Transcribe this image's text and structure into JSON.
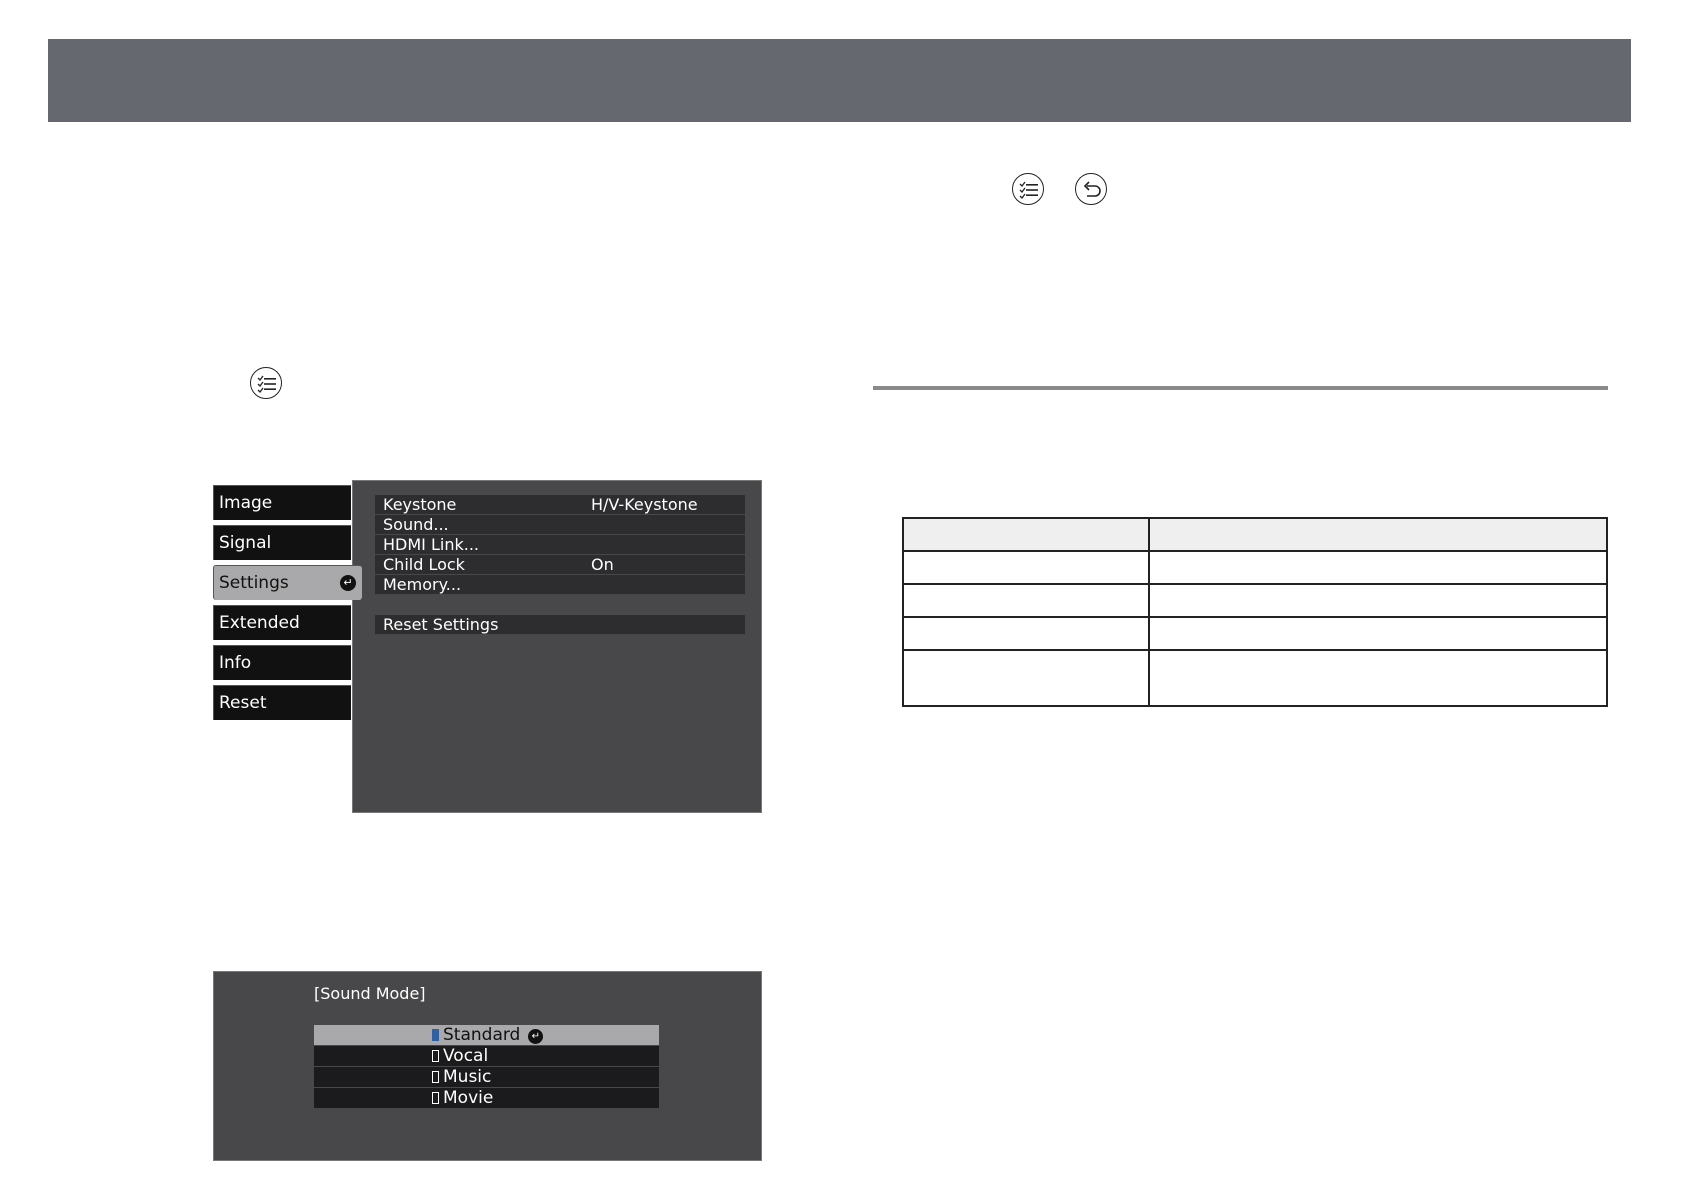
{
  "icons": {
    "top_menu_icon": "menu-list-icon",
    "top_back_icon": "back-arrow-icon",
    "left_menu_icon": "menu-list-icon"
  },
  "settings_menu": {
    "tabs": [
      "Image",
      "Signal",
      "Settings",
      "Extended",
      "Info",
      "Reset"
    ],
    "active_tab": "Settings",
    "rows": [
      {
        "label": "Keystone",
        "value": "H/V-Keystone"
      },
      {
        "label": "Sound...",
        "value": ""
      },
      {
        "label": "HDMI Link...",
        "value": ""
      },
      {
        "label": "Child Lock",
        "value": "On"
      },
      {
        "label": "Memory...",
        "value": ""
      }
    ],
    "reset_row": "Reset Settings"
  },
  "sound_mode": {
    "title": "[Sound Mode]",
    "options": [
      "Standard",
      "Vocal",
      "Music",
      "Movie"
    ],
    "selected": "Standard"
  },
  "table": {
    "header": [
      "",
      ""
    ],
    "rows": [
      [
        "",
        ""
      ],
      [
        "",
        ""
      ],
      [
        "",
        ""
      ],
      [
        "",
        ""
      ]
    ]
  },
  "colors": {
    "header_bar": "#666870",
    "menu_panel": "#48484a",
    "selected_item": "#a9a9ab"
  }
}
